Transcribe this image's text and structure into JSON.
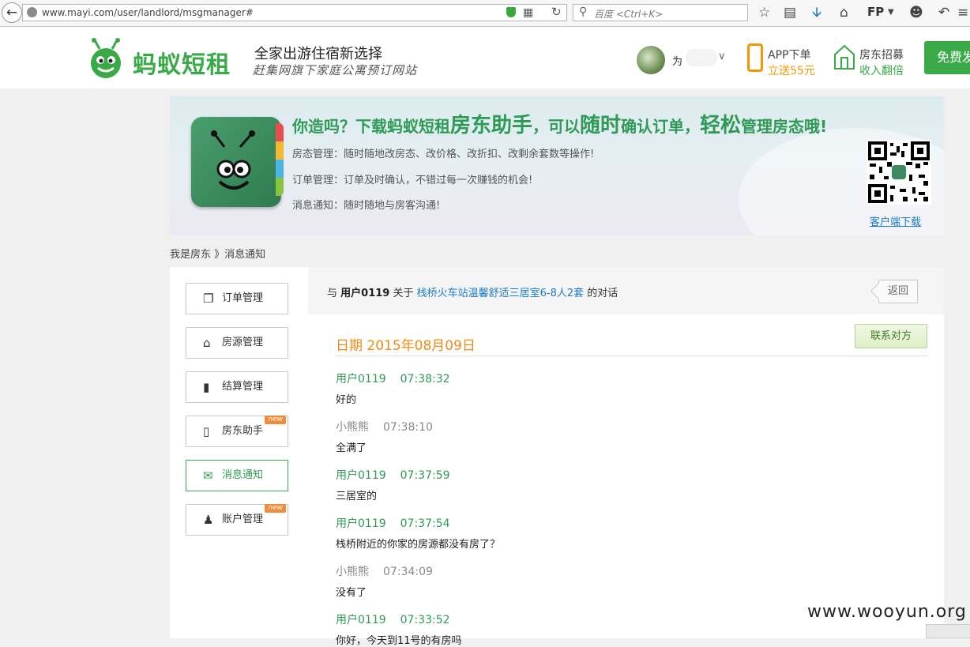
{
  "browser": {
    "url": "www.mayi.com/user/landlord/msgmanager#",
    "search_placeholder": "百度 <Ctrl+K>",
    "fp_label": "FP"
  },
  "header": {
    "logo_text": "蚂蚁短租",
    "slogan_main": "全家出游住宿新选择",
    "slogan_sub": "赶集网旗下家庭公寓预订网站",
    "username": "为",
    "app_line1": "APP下单",
    "app_line2": "立送55元",
    "recruit_line1": "房东招募",
    "recruit_line2": "收入翻倍",
    "free_button": "免费发布"
  },
  "banner": {
    "title_part1": "你造吗？下载蚂蚁短租",
    "title_part2": "房东助手",
    "title_part3": "，可以",
    "title_part4": "随时",
    "title_part5": "确认订单，",
    "title_part6": "轻松",
    "title_part7": "管理房态哦!",
    "line1": "房态管理：随时随地改房态、改价格、改折扣、改剩余套数等操作!",
    "line2": "订单管理：订单及时确认，不错过每一次赚钱的机会!",
    "line3": "消息通知：随时随地与房客沟通!",
    "download_link": "客户端下载"
  },
  "breadcrumb": "我是房东 》消息通知",
  "sidebar": {
    "items": [
      {
        "label": "订单管理",
        "icon": "document-icon"
      },
      {
        "label": "房源管理",
        "icon": "house-icon"
      },
      {
        "label": "结算管理",
        "icon": "clipboard-icon"
      },
      {
        "label": "房东助手",
        "icon": "phone-icon",
        "badge": "new"
      },
      {
        "label": "消息通知",
        "icon": "envelope-icon"
      },
      {
        "label": "账户管理",
        "icon": "user-icon",
        "badge": "new"
      }
    ]
  },
  "conversation": {
    "prefix": "与",
    "user": "用户0119",
    "about": "关于",
    "listing": "栈桥火车站温馨舒适三居室6-8人2套",
    "suffix": "的对话",
    "back_label": "返回",
    "contact_label": "联系对方",
    "date": "日期 2015年08月09日"
  },
  "messages": [
    {
      "sender": "用户0119",
      "time": "07:38:32",
      "text": "好的",
      "role": "user"
    },
    {
      "sender": "小熊熊",
      "time": "07:38:10",
      "text": "全满了",
      "role": "host"
    },
    {
      "sender": "用户0119",
      "time": "07:37:59",
      "text": "三居室的",
      "role": "user"
    },
    {
      "sender": "用户0119",
      "time": "07:37:54",
      "text": "栈桥附近的你家的房源都没有房了？",
      "role": "user"
    },
    {
      "sender": "小熊熊",
      "time": "07:34:09",
      "text": "没有了",
      "role": "host"
    },
    {
      "sender": "用户0119",
      "time": "07:33:52",
      "text": "你好，今天到11号的有房吗",
      "role": "user"
    }
  ],
  "watermark": "www.wooyun.org",
  "colors": {
    "brand_green": "#3aaa48",
    "accent_orange": "#f08b14",
    "link_blue": "#1c7bc7"
  }
}
